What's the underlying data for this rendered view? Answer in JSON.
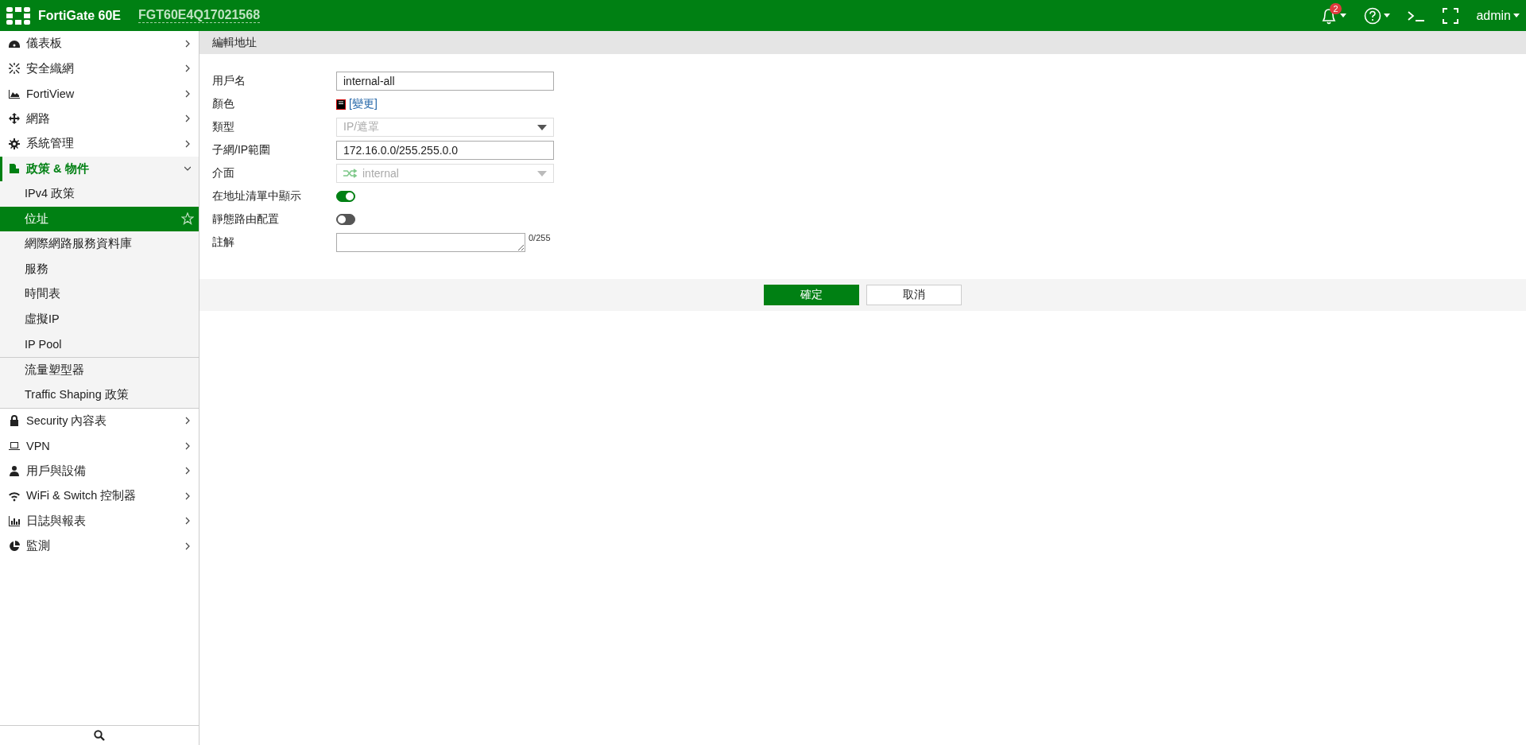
{
  "topbar": {
    "product": "FortiGate 60E",
    "serial": "FGT60E4Q17021568",
    "notification_count": "2",
    "user": "admin"
  },
  "sidebar": {
    "items": [
      {
        "label": "儀表板",
        "expanded": false
      },
      {
        "label": "安全織網",
        "expanded": false
      },
      {
        "label": "FortiView",
        "expanded": false
      },
      {
        "label": "網路",
        "expanded": false
      },
      {
        "label": "系統管理",
        "expanded": false
      },
      {
        "label": "政策 & 物件",
        "expanded": true,
        "groups": [
          {
            "children": [
              {
                "label": "IPv4 政策",
                "selected": false
              },
              {
                "label": "位址",
                "selected": true
              },
              {
                "label": "網際網路服務資料庫",
                "selected": false
              },
              {
                "label": "服務",
                "selected": false
              },
              {
                "label": "時間表",
                "selected": false
              },
              {
                "label": "虛擬IP",
                "selected": false
              },
              {
                "label": "IP Pool",
                "selected": false
              }
            ]
          },
          {
            "children": [
              {
                "label": "流量塑型器",
                "selected": false
              },
              {
                "label": "Traffic Shaping 政策",
                "selected": false
              }
            ]
          }
        ]
      },
      {
        "label": "Security 內容表",
        "expanded": false
      },
      {
        "label": "VPN",
        "expanded": false
      },
      {
        "label": "用戶與設備",
        "expanded": false
      },
      {
        "label": "WiFi & Switch 控制器",
        "expanded": false
      },
      {
        "label": "日誌與報表",
        "expanded": false
      },
      {
        "label": "監測",
        "expanded": false
      }
    ]
  },
  "page": {
    "title": "編輯地址",
    "fields": [
      {
        "kind": "text",
        "label": "用戶名",
        "value": "internal-all"
      },
      {
        "kind": "color",
        "label": "顏色",
        "link": "[變更]"
      },
      {
        "kind": "select",
        "label": "類型",
        "value": "IP/遮罩",
        "disabled": true
      },
      {
        "kind": "text",
        "label": "子網/IP範圍",
        "value": "172.16.0.0/255.255.0.0"
      },
      {
        "kind": "interface",
        "label": "介面",
        "value": "internal",
        "disabled": true
      },
      {
        "kind": "toggle",
        "label": "在地址清單中顯示",
        "on": true
      },
      {
        "kind": "toggle",
        "label": "靜態路由配置",
        "on": false
      },
      {
        "kind": "textarea",
        "label": "註解",
        "counter": "0/255"
      }
    ],
    "buttons": [
      {
        "label": "確定",
        "kind": "primary"
      },
      {
        "label": "取消",
        "kind": "secondary"
      }
    ]
  }
}
